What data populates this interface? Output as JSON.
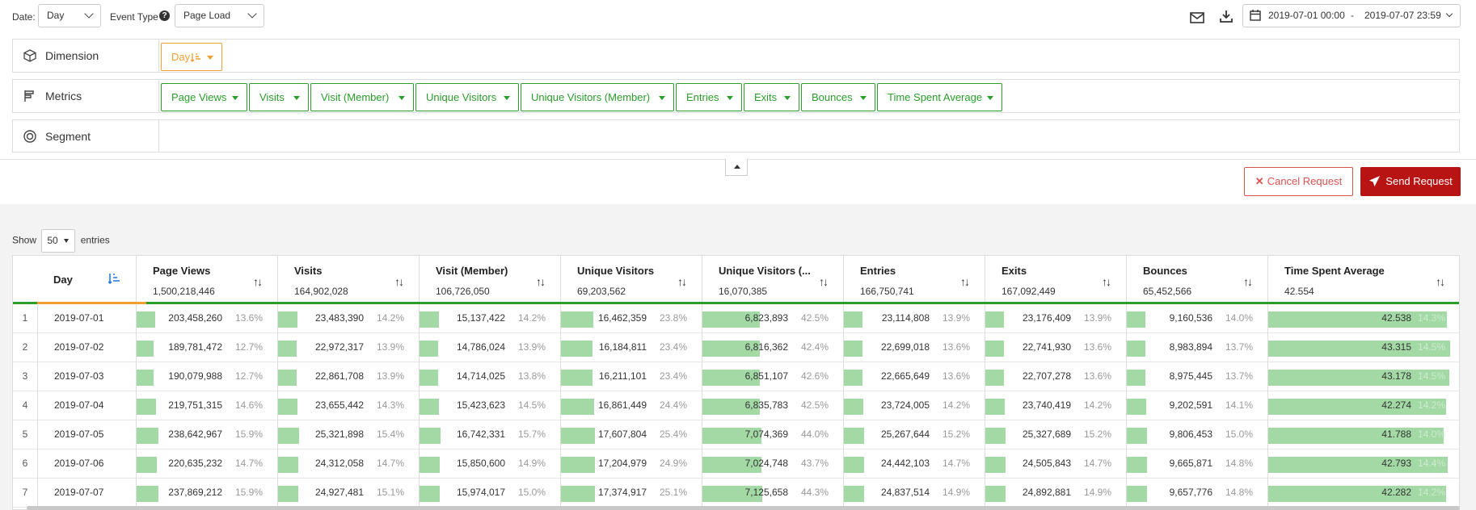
{
  "toolbar": {
    "date_label": "Date:",
    "date_value": "Day",
    "event_label": "Event Type",
    "event_value": "Page Load",
    "date_range_start": "2019-07-01 00:00",
    "date_range_sep": "-",
    "date_range_end": "2019-07-07 23:59"
  },
  "filters": {
    "dimension_label": "Dimension",
    "dimension_chip": "Day",
    "metrics_label": "Metrics",
    "metrics": [
      "Page Views",
      "Visits",
      "Visit (Member)",
      "Unique Visitors",
      "Unique Visitors (Member)",
      "Entries",
      "Exits",
      "Bounces",
      "Time Spent Average"
    ],
    "segment_label": "Segment"
  },
  "actions": {
    "cancel": "Cancel Request",
    "send": "Send Request"
  },
  "show": {
    "prefix": "Show",
    "count": "50",
    "suffix": "entries"
  },
  "table": {
    "day_header": "Day",
    "columns": [
      {
        "name": "Page Views",
        "total": "1,500,218,446"
      },
      {
        "name": "Visits",
        "total": "164,902,028"
      },
      {
        "name": "Visit (Member)",
        "total": "106,726,050"
      },
      {
        "name": "Unique Visitors",
        "total": "69,203,562"
      },
      {
        "name": "Unique Visitors (...",
        "total": "16,070,385"
      },
      {
        "name": "Entries",
        "total": "166,750,741"
      },
      {
        "name": "Exits",
        "total": "167,092,449"
      },
      {
        "name": "Bounces",
        "total": "65,452,566"
      },
      {
        "name": "Time Spent Average",
        "total": "42.554"
      }
    ],
    "rows": [
      {
        "idx": "1",
        "day": "2019-07-01",
        "cells": [
          [
            "203,458,260",
            "13.6%",
            0.136
          ],
          [
            "23,483,390",
            "14.2%",
            0.142
          ],
          [
            "15,137,422",
            "14.2%",
            0.142
          ],
          [
            "16,462,359",
            "23.8%",
            0.238
          ],
          [
            "6,823,893",
            "42.5%",
            0.425
          ],
          [
            "23,114,808",
            "13.9%",
            0.139
          ],
          [
            "23,176,409",
            "13.9%",
            0.139
          ],
          [
            "9,160,536",
            "14.0%",
            0.14
          ],
          [
            "42.538",
            "14.3%",
            0.96
          ]
        ]
      },
      {
        "idx": "2",
        "day": "2019-07-02",
        "cells": [
          [
            "189,781,472",
            "12.7%",
            0.127
          ],
          [
            "22,972,317",
            "13.9%",
            0.139
          ],
          [
            "14,786,024",
            "13.9%",
            0.139
          ],
          [
            "16,184,811",
            "23.4%",
            0.234
          ],
          [
            "6,816,362",
            "42.4%",
            0.424
          ],
          [
            "22,699,018",
            "13.6%",
            0.136
          ],
          [
            "22,741,930",
            "13.6%",
            0.136
          ],
          [
            "8,983,894",
            "13.7%",
            0.137
          ],
          [
            "43.315",
            "14.5%",
            0.98
          ]
        ]
      },
      {
        "idx": "3",
        "day": "2019-07-03",
        "cells": [
          [
            "190,079,988",
            "12.7%",
            0.127
          ],
          [
            "22,861,708",
            "13.9%",
            0.139
          ],
          [
            "14,714,025",
            "13.8%",
            0.138
          ],
          [
            "16,211,101",
            "23.4%",
            0.234
          ],
          [
            "6,851,107",
            "42.6%",
            0.426
          ],
          [
            "22,665,649",
            "13.6%",
            0.136
          ],
          [
            "22,707,278",
            "13.6%",
            0.136
          ],
          [
            "8,975,445",
            "13.7%",
            0.137
          ],
          [
            "43.178",
            "14.5%",
            0.975
          ]
        ]
      },
      {
        "idx": "4",
        "day": "2019-07-04",
        "cells": [
          [
            "219,751,315",
            "14.6%",
            0.146
          ],
          [
            "23,655,442",
            "14.3%",
            0.143
          ],
          [
            "15,423,623",
            "14.5%",
            0.145
          ],
          [
            "16,861,449",
            "24.4%",
            0.244
          ],
          [
            "6,835,783",
            "42.5%",
            0.425
          ],
          [
            "23,724,005",
            "14.2%",
            0.142
          ],
          [
            "23,740,419",
            "14.2%",
            0.142
          ],
          [
            "9,202,591",
            "14.1%",
            0.141
          ],
          [
            "42.274",
            "14.2%",
            0.955
          ]
        ]
      },
      {
        "idx": "5",
        "day": "2019-07-05",
        "cells": [
          [
            "238,642,967",
            "15.9%",
            0.159
          ],
          [
            "25,321,898",
            "15.4%",
            0.154
          ],
          [
            "16,742,331",
            "15.7%",
            0.157
          ],
          [
            "17,607,804",
            "25.4%",
            0.254
          ],
          [
            "7,074,369",
            "44.0%",
            0.44
          ],
          [
            "25,267,644",
            "15.2%",
            0.152
          ],
          [
            "25,327,689",
            "15.2%",
            0.152
          ],
          [
            "9,806,453",
            "15.0%",
            0.15
          ],
          [
            "41.788",
            "14.0%",
            0.944
          ]
        ]
      },
      {
        "idx": "6",
        "day": "2019-07-06",
        "cells": [
          [
            "220,635,232",
            "14.7%",
            0.147
          ],
          [
            "24,312,058",
            "14.7%",
            0.147
          ],
          [
            "15,850,600",
            "14.9%",
            0.149
          ],
          [
            "17,204,979",
            "24.9%",
            0.249
          ],
          [
            "7,024,748",
            "43.7%",
            0.437
          ],
          [
            "24,442,103",
            "14.7%",
            0.147
          ],
          [
            "24,505,843",
            "14.7%",
            0.147
          ],
          [
            "9,665,871",
            "14.8%",
            0.148
          ],
          [
            "42.793",
            "14.4%",
            0.967
          ]
        ]
      },
      {
        "idx": "7",
        "day": "2019-07-07",
        "cells": [
          [
            "237,869,212",
            "15.9%",
            0.159
          ],
          [
            "24,927,481",
            "15.1%",
            0.151
          ],
          [
            "15,974,017",
            "15.0%",
            0.15
          ],
          [
            "17,374,917",
            "25.1%",
            0.251
          ],
          [
            "7,125,658",
            "44.3%",
            0.443
          ],
          [
            "24,837,514",
            "14.9%",
            0.149
          ],
          [
            "24,892,881",
            "14.9%",
            0.149
          ],
          [
            "9,657,776",
            "14.8%",
            0.148
          ],
          [
            "42.282",
            "14.2%",
            0.955
          ]
        ]
      }
    ]
  }
}
